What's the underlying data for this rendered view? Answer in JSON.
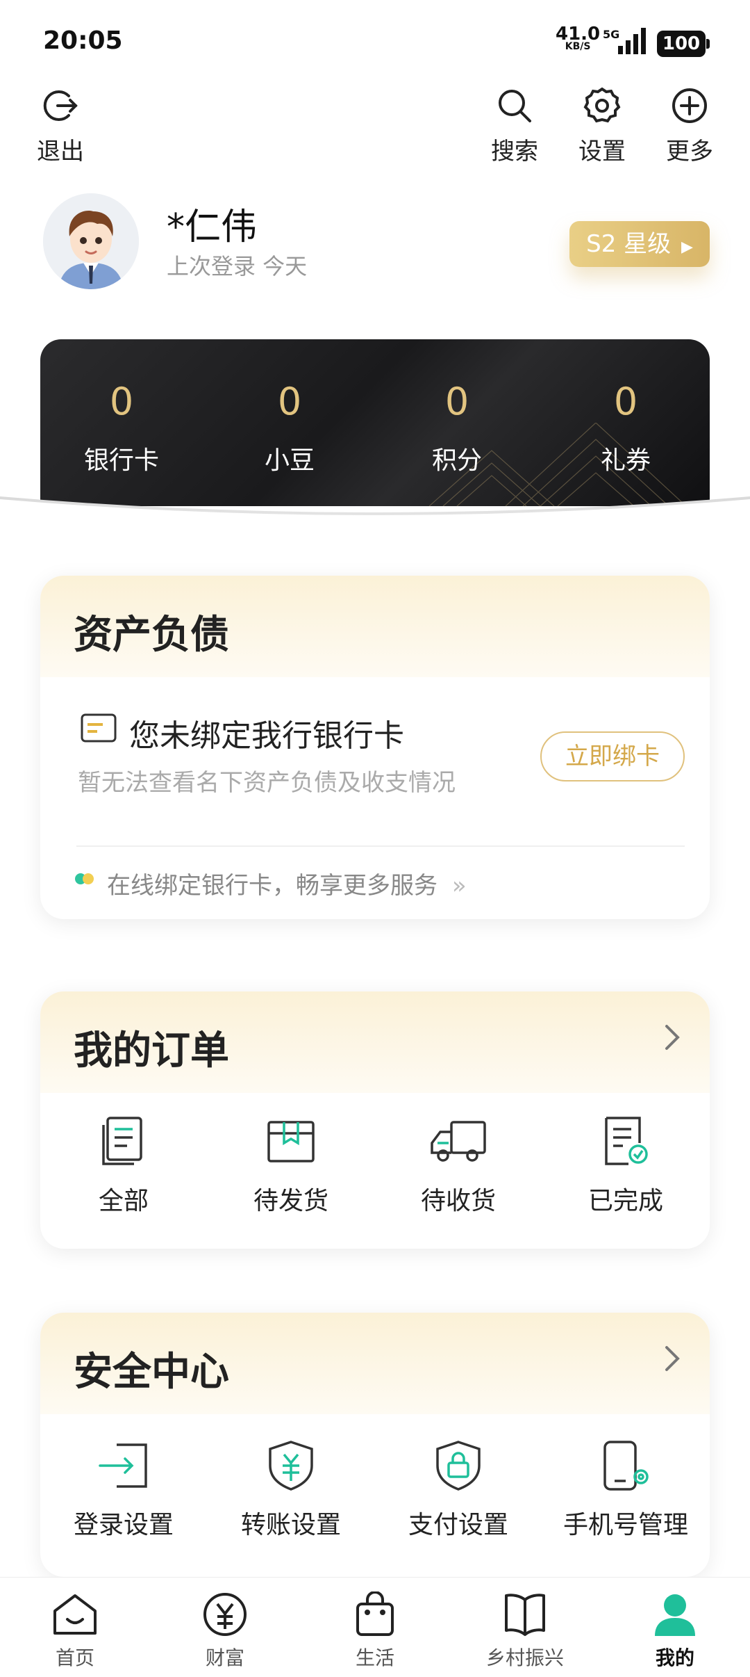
{
  "status_bar": {
    "time": "20:05",
    "net_speed": "41.0",
    "net_speed_unit": "KB/S",
    "net_type": "5G",
    "battery": "100"
  },
  "top_actions": {
    "logout": "退出",
    "search": "搜索",
    "settings": "设置",
    "more": "更多"
  },
  "profile": {
    "name": "*仁伟",
    "last_login": "上次登录 今天",
    "level_badge": "S2 星级"
  },
  "stats": [
    {
      "value": "0",
      "label": "银行卡"
    },
    {
      "value": "0",
      "label": "小豆"
    },
    {
      "value": "0",
      "label": "积分"
    },
    {
      "value": "0",
      "label": "礼券"
    }
  ],
  "assets": {
    "title": "资产负债",
    "bind_title": "您未绑定我行银行卡",
    "bind_desc": "暂无法查看名下资产负债及收支情况",
    "bind_button": "立即绑卡",
    "tip": "在线绑定银行卡，畅享更多服务"
  },
  "orders": {
    "title": "我的订单",
    "items": [
      {
        "label": "全部",
        "icon": "document-stack-icon"
      },
      {
        "label": "待发货",
        "icon": "package-icon"
      },
      {
        "label": "待收货",
        "icon": "truck-icon"
      },
      {
        "label": "已完成",
        "icon": "document-check-icon"
      }
    ]
  },
  "security": {
    "title": "安全中心",
    "items": [
      {
        "label": "登录设置",
        "icon": "login-icon"
      },
      {
        "label": "转账设置",
        "icon": "shield-yuan-icon"
      },
      {
        "label": "支付设置",
        "icon": "shield-lock-icon"
      },
      {
        "label": "手机号管理",
        "icon": "phone-gear-icon"
      }
    ]
  },
  "tabs": [
    {
      "label": "首页",
      "icon": "home-icon"
    },
    {
      "label": "财富",
      "icon": "yuan-circle-icon"
    },
    {
      "label": "生活",
      "icon": "shopping-bag-icon"
    },
    {
      "label": "乡村振兴",
      "icon": "book-icon"
    },
    {
      "label": "我的",
      "icon": "person-icon",
      "active": true
    }
  ],
  "colors": {
    "accent_gold": "#d8b567",
    "accent_green": "#1fbf9a",
    "text_dark": "#222222"
  }
}
